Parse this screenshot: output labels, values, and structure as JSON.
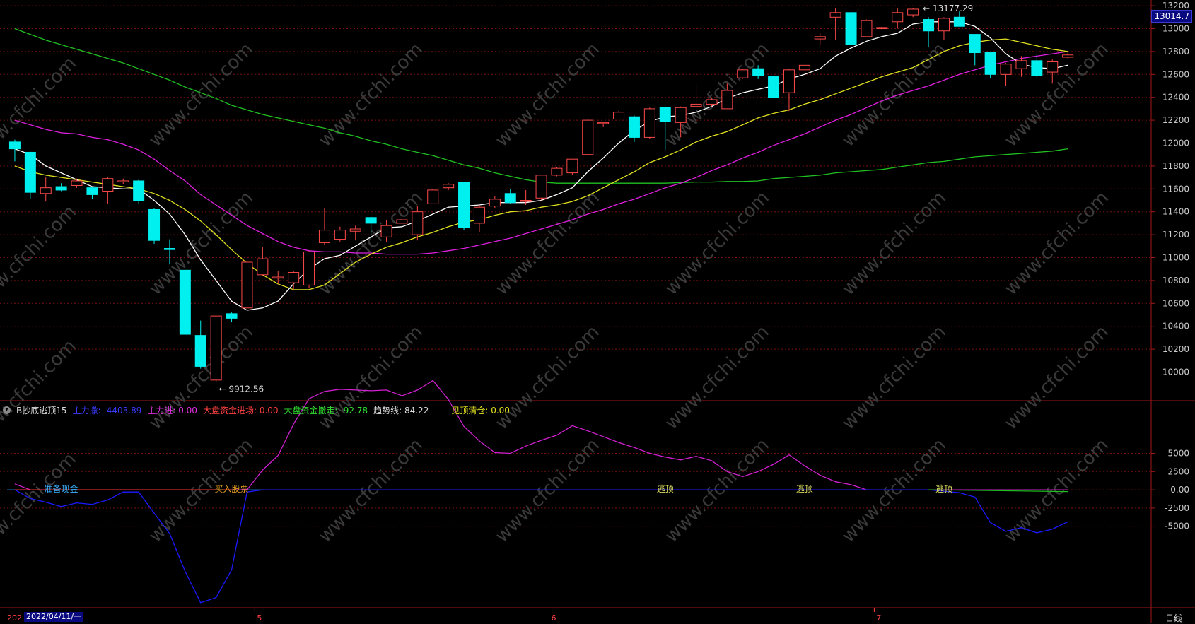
{
  "colors": {
    "up": "#ff4a4a",
    "down": "#00f0f0",
    "ma5": "#ffffff",
    "ma10": "#e0e020",
    "ma20": "#e020e0",
    "ma60": "#20c020",
    "main_out": "#1a1aff",
    "main_in": "#d020d0",
    "grid": "#7a1010",
    "axis_text": "#cccccc"
  },
  "price_axis": {
    "ticks": [
      "13200",
      "13000",
      "12800",
      "12600",
      "12400",
      "12200",
      "12000",
      "11800",
      "11600",
      "11400",
      "11200",
      "11000",
      "10800",
      "10600",
      "10400",
      "10200",
      "10000"
    ],
    "current_price": "13014.7"
  },
  "annotations": {
    "high_label": "13177.29",
    "low_label": "9912.56"
  },
  "indicator": {
    "name": "B抄底逃顶15",
    "main_out_label": "主力撤:",
    "main_out_value": "-4403.89",
    "main_in_label": "主力进:",
    "main_in_value": "0.00",
    "market_in_label": "大盘资金进场:",
    "market_in_value": "0.00",
    "market_out_label": "大盘资金撤走:",
    "market_out_value": "-92.78",
    "trend_label": "趋势线:",
    "trend_value": "84.22",
    "top_clear_label": "见顶清仓:",
    "top_clear_value": "0.00",
    "axis_ticks": [
      "5000",
      "2500",
      "0.00",
      "-2500",
      "-5000"
    ],
    "signals": [
      "准备现金",
      "买入股票",
      "逃顶",
      "逃顶",
      "逃顶"
    ]
  },
  "time_axis": {
    "year_label": "202",
    "current_date": "2022/04/11/一",
    "months": [
      "5",
      "6",
      "7"
    ],
    "period": "日线"
  },
  "watermark": "www.cfchi.com",
  "chart_data": {
    "type": "candlestick",
    "title": "",
    "candles": [
      [
        12010,
        12030,
        11840,
        11950
      ],
      [
        11920,
        11925,
        11510,
        11570
      ],
      [
        11560,
        11700,
        11490,
        11610
      ],
      [
        11620,
        11650,
        11580,
        11590
      ],
      [
        11630,
        11690,
        11610,
        11670
      ],
      [
        11610,
        11620,
        11510,
        11550
      ],
      [
        11580,
        11700,
        11470,
        11690
      ],
      [
        11670,
        11690,
        11640,
        11670
      ],
      [
        11670,
        11680,
        11470,
        11500
      ],
      [
        11420,
        11430,
        11120,
        11150
      ],
      [
        11080,
        11160,
        10940,
        11070
      ],
      [
        10890,
        10890,
        10330,
        10330
      ],
      [
        10320,
        10450,
        10030,
        10050
      ],
      [
        9930,
        10490,
        9910,
        10490
      ],
      [
        10510,
        10520,
        10440,
        10470
      ],
      [
        10560,
        10960,
        10560,
        10960
      ],
      [
        10850,
        11090,
        10840,
        10990
      ],
      [
        10820,
        10880,
        10770,
        10830
      ],
      [
        10780,
        10880,
        10720,
        10870
      ],
      [
        10760,
        11060,
        10730,
        11050
      ],
      [
        11130,
        11430,
        11110,
        11240
      ],
      [
        11160,
        11270,
        11140,
        11240
      ],
      [
        11230,
        11280,
        11150,
        11250
      ],
      [
        11350,
        11360,
        11200,
        11300
      ],
      [
        11180,
        11330,
        11140,
        11280
      ],
      [
        11300,
        11360,
        11290,
        11330
      ],
      [
        11200,
        11450,
        11150,
        11400
      ],
      [
        11470,
        11600,
        11480,
        11590
      ],
      [
        11610,
        11650,
        11590,
        11640
      ],
      [
        11660,
        11660,
        11240,
        11260
      ],
      [
        11300,
        11460,
        11220,
        11440
      ],
      [
        11450,
        11540,
        11430,
        11510
      ],
      [
        11560,
        11600,
        11470,
        11480
      ],
      [
        11500,
        11590,
        11460,
        11500
      ],
      [
        11520,
        11720,
        11500,
        11720
      ],
      [
        11720,
        11790,
        11710,
        11780
      ],
      [
        11740,
        11860,
        11720,
        11860
      ],
      [
        11900,
        12210,
        11900,
        12200
      ],
      [
        12180,
        12180,
        12140,
        12180
      ],
      [
        12210,
        12280,
        12210,
        12270
      ],
      [
        12230,
        12240,
        12010,
        12050
      ],
      [
        12050,
        12310,
        12040,
        12300
      ],
      [
        12310,
        12320,
        11940,
        12190
      ],
      [
        12180,
        12320,
        12050,
        12310
      ],
      [
        12320,
        12510,
        12320,
        12340
      ],
      [
        12340,
        12390,
        12320,
        12380
      ],
      [
        12300,
        12520,
        12320,
        12460
      ],
      [
        12570,
        12650,
        12560,
        12640
      ],
      [
        12650,
        12680,
        12560,
        12590
      ],
      [
        12580,
        12590,
        12410,
        12400
      ],
      [
        12440,
        12650,
        12280,
        12640
      ],
      [
        12640,
        12680,
        12640,
        12680
      ],
      [
        12910,
        12960,
        12860,
        12930
      ],
      [
        13100,
        13180,
        12900,
        13140
      ],
      [
        13140,
        13160,
        12800,
        12860
      ],
      [
        12930,
        13080,
        12930,
        13070
      ],
      [
        13000,
        13020,
        12990,
        13010
      ],
      [
        13060,
        13180,
        13000,
        13140
      ],
      [
        13120,
        13180,
        13100,
        13170
      ],
      [
        13080,
        13100,
        12840,
        12980
      ],
      [
        12980,
        13100,
        12900,
        13090
      ],
      [
        13100,
        13150,
        13020,
        13020
      ],
      [
        12950,
        12950,
        12680,
        12790
      ],
      [
        12790,
        12790,
        12570,
        12600
      ],
      [
        12600,
        12700,
        12500,
        12690
      ],
      [
        12650,
        12760,
        12580,
        12720
      ],
      [
        12720,
        12780,
        12570,
        12590
      ],
      [
        12620,
        12730,
        12520,
        12710
      ],
      [
        12750,
        12790,
        12740,
        12770
      ]
    ],
    "ma5": [
      11950,
      11900,
      11800,
      11740,
      11680,
      11620,
      11610,
      11600,
      11600,
      11500,
      11380,
      11200,
      10980,
      10800,
      10620,
      10540,
      10560,
      10620,
      10770,
      10900,
      10990,
      11020,
      11100,
      11180,
      11260,
      11270,
      11320,
      11380,
      11440,
      11450,
      11460,
      11480,
      11480,
      11480,
      11500,
      11550,
      11610,
      11750,
      11870,
      12000,
      12110,
      12190,
      12230,
      12240,
      12270,
      12320,
      12390,
      12440,
      12470,
      12500,
      12560,
      12600,
      12650,
      12760,
      12830,
      12890,
      12930,
      12960,
      13040,
      13060,
      13060,
      13060,
      13020,
      12920,
      12780,
      12690,
      12660,
      12650,
      12680
    ],
    "ma10": [
      11800,
      11750,
      11720,
      11700,
      11680,
      11660,
      11640,
      11620,
      11600,
      11560,
      11500,
      11420,
      11320,
      11200,
      11070,
      10950,
      10850,
      10770,
      10720,
      10720,
      10760,
      10860,
      10960,
      11030,
      11090,
      11130,
      11180,
      11220,
      11270,
      11310,
      11330,
      11370,
      11400,
      11410,
      11440,
      11460,
      11490,
      11540,
      11610,
      11680,
      11750,
      11830,
      11880,
      11940,
      12010,
      12060,
      12100,
      12160,
      12220,
      12260,
      12290,
      12340,
      12380,
      12430,
      12480,
      12530,
      12580,
      12620,
      12660,
      12730,
      12800,
      12850,
      12880,
      12900,
      12910,
      12880,
      12850,
      12820,
      12800
    ],
    "ma20": [
      12200,
      12160,
      12120,
      12090,
      12080,
      12050,
      12030,
      11990,
      11940,
      11860,
      11760,
      11670,
      11550,
      11460,
      11370,
      11280,
      11210,
      11140,
      11090,
      11060,
      11050,
      11050,
      11040,
      11040,
      11030,
      11030,
      11030,
      11040,
      11060,
      11080,
      11110,
      11140,
      11170,
      11210,
      11250,
      11290,
      11330,
      11380,
      11420,
      11470,
      11510,
      11560,
      11610,
      11650,
      11700,
      11760,
      11810,
      11870,
      11920,
      11980,
      12030,
      12080,
      12140,
      12200,
      12250,
      12310,
      12370,
      12420,
      12460,
      12500,
      12550,
      12600,
      12640,
      12680,
      12710,
      12740,
      12760,
      12780,
      12800
    ],
    "ma60": [
      13000,
      12950,
      12900,
      12860,
      12820,
      12780,
      12740,
      12700,
      12650,
      12600,
      12550,
      12490,
      12440,
      12390,
      12330,
      12290,
      12250,
      12220,
      12190,
      12160,
      12130,
      12090,
      12060,
      12020,
      11990,
      11950,
      11920,
      11890,
      11850,
      11810,
      11780,
      11740,
      11710,
      11680,
      11660,
      11650,
      11650,
      11650,
      11650,
      11650,
      11650,
      11650,
      11650,
      11655,
      11660,
      11660,
      11665,
      11665,
      11670,
      11690,
      11700,
      11710,
      11720,
      11740,
      11750,
      11760,
      11770,
      11790,
      11810,
      11830,
      11840,
      11860,
      11880,
      11890,
      11900,
      11910,
      11920,
      11930,
      11950
    ],
    "main_out": [
      0,
      -1200,
      -1700,
      -2300,
      -1800,
      -2000,
      -1400,
      -300,
      -300,
      -3200,
      -6000,
      -11200,
      -15500,
      -14800,
      -11000,
      -300,
      0,
      0,
      0,
      0,
      0,
      0,
      0,
      0,
      0,
      0,
      0,
      0,
      0,
      0,
      0,
      0,
      0,
      0,
      0,
      0,
      0,
      0,
      0,
      0,
      0,
      0,
      0,
      0,
      0,
      0,
      0,
      0,
      0,
      0,
      0,
      0,
      0,
      0,
      0,
      0,
      0,
      0,
      0,
      0,
      -200,
      -400,
      -1000,
      -4500,
      -5700,
      -5200,
      -5900,
      -5400,
      -4400
    ],
    "main_in": [
      800,
      0,
      0,
      0,
      0,
      0,
      0,
      0,
      0,
      0,
      0,
      0,
      0,
      0,
      0,
      0,
      2700,
      4700,
      9000,
      12500,
      13500,
      13800,
      13700,
      13600,
      13700,
      12900,
      13700,
      15000,
      12400,
      8700,
      6700,
      5100,
      5000,
      6000,
      6800,
      7500,
      8800,
      8100,
      7300,
      6500,
      5800,
      5000,
      4500,
      4100,
      4600,
      4000,
      2500,
      1800,
      2500,
      3500,
      4800,
      3300,
      2000,
      1100,
      700,
      0,
      0,
      0,
      0,
      0,
      0,
      0,
      0,
      0,
      0,
      0,
      0,
      0,
      0
    ],
    "signals": [
      {
        "i": 3,
        "label": "准备现金",
        "type": "buy"
      },
      {
        "i": 14,
        "label": "买入股票",
        "type": "buy"
      },
      {
        "i": 42,
        "label": "逃顶",
        "type": "top"
      },
      {
        "i": 51,
        "label": "逃顶",
        "type": "top"
      },
      {
        "i": 60,
        "label": "逃顶",
        "type": "top"
      }
    ],
    "ylim": [
      9750,
      13250
    ],
    "indicator_ylim": [
      -16000,
      10000
    ],
    "high": {
      "i": 58,
      "value": 13177.29
    },
    "low": {
      "i": 13,
      "value": 9912.56
    }
  }
}
